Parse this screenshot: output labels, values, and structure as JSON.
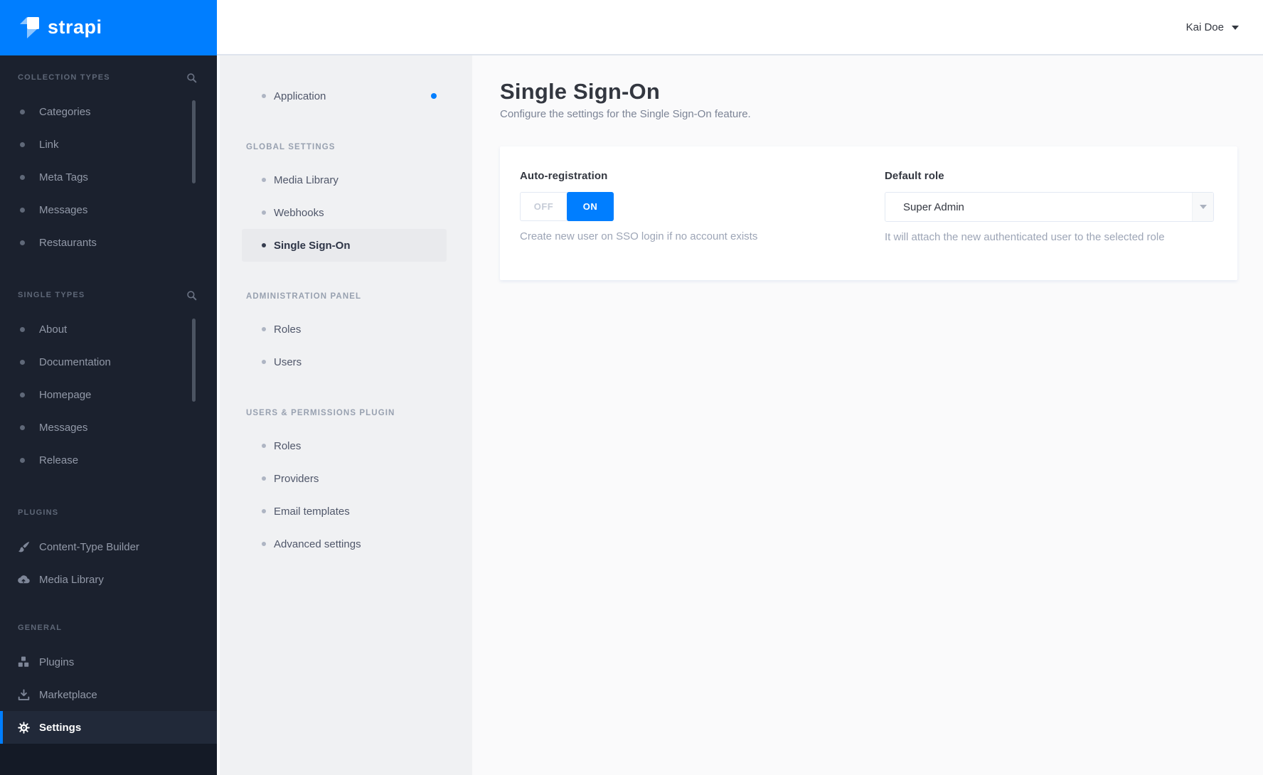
{
  "brand": {
    "name": "strapi"
  },
  "topbar": {
    "user_name": "Kai Doe"
  },
  "colors": {
    "accent_blue": "#007EFF",
    "sidebar_bg": "#1B212E",
    "sidebar_footer_bg": "#141A26",
    "subnav_bg": "#F0F1F3",
    "subnav_active_bg": "#E9EAED",
    "main_bg": "#FAFAFB",
    "card_bg": "#FFFFFF",
    "title_text": "#333740",
    "muted_text": "#9DA5B6",
    "border": "#E3E9F3"
  },
  "sidebar": {
    "sections": [
      {
        "title": "COLLECTION TYPES",
        "search_icon": "search-icon",
        "items": [
          {
            "label": "Categories"
          },
          {
            "label": "Link"
          },
          {
            "label": "Meta Tags"
          },
          {
            "label": "Messages"
          },
          {
            "label": "Restaurants"
          }
        ]
      },
      {
        "title": "SINGLE TYPES",
        "search_icon": "search-icon",
        "items": [
          {
            "label": "About"
          },
          {
            "label": "Documentation"
          },
          {
            "label": "Homepage"
          },
          {
            "label": "Messages"
          },
          {
            "label": "Release"
          }
        ]
      },
      {
        "title": "PLUGINS",
        "items": [
          {
            "label": "Content-Type Builder",
            "icon": "paintbrush-icon"
          },
          {
            "label": "Media Library",
            "icon": "cloud-upload-icon"
          }
        ]
      },
      {
        "title": "GENERAL",
        "items": [
          {
            "label": "Plugins",
            "icon": "cubes-icon"
          },
          {
            "label": "Marketplace",
            "icon": "download-icon"
          },
          {
            "label": "Settings",
            "icon": "gear-icon",
            "active": true
          }
        ]
      }
    ]
  },
  "subnav": {
    "groups": [
      {
        "title": "",
        "items": [
          {
            "label": "Application",
            "notification": true
          }
        ]
      },
      {
        "title": "GLOBAL SETTINGS",
        "items": [
          {
            "label": "Media Library"
          },
          {
            "label": "Webhooks"
          },
          {
            "label": "Single Sign-On",
            "active": true
          }
        ]
      },
      {
        "title": "ADMINISTRATION PANEL",
        "items": [
          {
            "label": "Roles"
          },
          {
            "label": "Users"
          }
        ]
      },
      {
        "title": "USERS & PERMISSIONS PLUGIN",
        "items": [
          {
            "label": "Roles"
          },
          {
            "label": "Providers"
          },
          {
            "label": "Email templates"
          },
          {
            "label": "Advanced settings"
          }
        ]
      }
    ]
  },
  "main": {
    "title": "Single Sign-On",
    "subtitle": "Configure the settings for the Single Sign-On feature.",
    "form": {
      "auto_registration": {
        "label": "Auto-registration",
        "off_label": "OFF",
        "on_label": "ON",
        "value": "ON",
        "helper": "Create new user on SSO login if no account exists"
      },
      "default_role": {
        "label": "Default role",
        "value": "Super Admin",
        "helper": "It will attach the new authenticated user to the selected role"
      }
    }
  }
}
